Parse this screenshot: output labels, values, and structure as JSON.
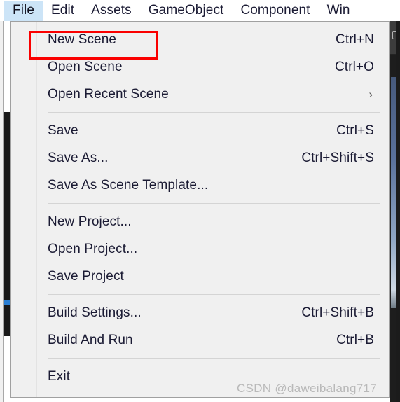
{
  "menubar": {
    "items": [
      {
        "label": "File",
        "active": true
      },
      {
        "label": "Edit",
        "active": false
      },
      {
        "label": "Assets",
        "active": false
      },
      {
        "label": "GameObject",
        "active": false
      },
      {
        "label": "Component",
        "active": false
      },
      {
        "label": "Win",
        "active": false
      }
    ]
  },
  "file_menu": {
    "groups": [
      {
        "items": [
          {
            "label": "New Scene",
            "shortcut": "Ctrl+N",
            "submenu": false,
            "highlighted": true
          },
          {
            "label": "Open Scene",
            "shortcut": "Ctrl+O",
            "submenu": false,
            "highlighted": false
          },
          {
            "label": "Open Recent Scene",
            "shortcut": "",
            "submenu": true,
            "highlighted": false
          }
        ]
      },
      {
        "items": [
          {
            "label": "Save",
            "shortcut": "Ctrl+S",
            "submenu": false,
            "highlighted": false
          },
          {
            "label": "Save As...",
            "shortcut": "Ctrl+Shift+S",
            "submenu": false,
            "highlighted": false
          },
          {
            "label": "Save As Scene Template...",
            "shortcut": "",
            "submenu": false,
            "highlighted": false
          }
        ]
      },
      {
        "items": [
          {
            "label": "New Project...",
            "shortcut": "",
            "submenu": false,
            "highlighted": false
          },
          {
            "label": "Open Project...",
            "shortcut": "",
            "submenu": false,
            "highlighted": false
          },
          {
            "label": "Save Project",
            "shortcut": "",
            "submenu": false,
            "highlighted": false
          }
        ]
      },
      {
        "items": [
          {
            "label": "Build Settings...",
            "shortcut": "Ctrl+Shift+B",
            "submenu": false,
            "highlighted": false
          },
          {
            "label": "Build And Run",
            "shortcut": "Ctrl+B",
            "submenu": false,
            "highlighted": false
          }
        ]
      },
      {
        "items": [
          {
            "label": "Exit",
            "shortcut": "",
            "submenu": false,
            "highlighted": false
          }
        ]
      }
    ],
    "submenu_arrow_glyph": "›"
  },
  "annotation": {
    "highlight_target": "New Scene",
    "highlight_color": "#fa0000"
  },
  "watermark": {
    "text": "CSDN @daweibalang717"
  },
  "colors": {
    "menu_background": "#f0f0f0",
    "menubar_background": "#ffffff",
    "active_tab_background": "#cce4f7",
    "text": "#1b1b34",
    "separator": "#d4d4d4",
    "panel_border": "#a0a0a0",
    "accent_blue": "#2a7fd4",
    "editor_dark": "#191919"
  }
}
